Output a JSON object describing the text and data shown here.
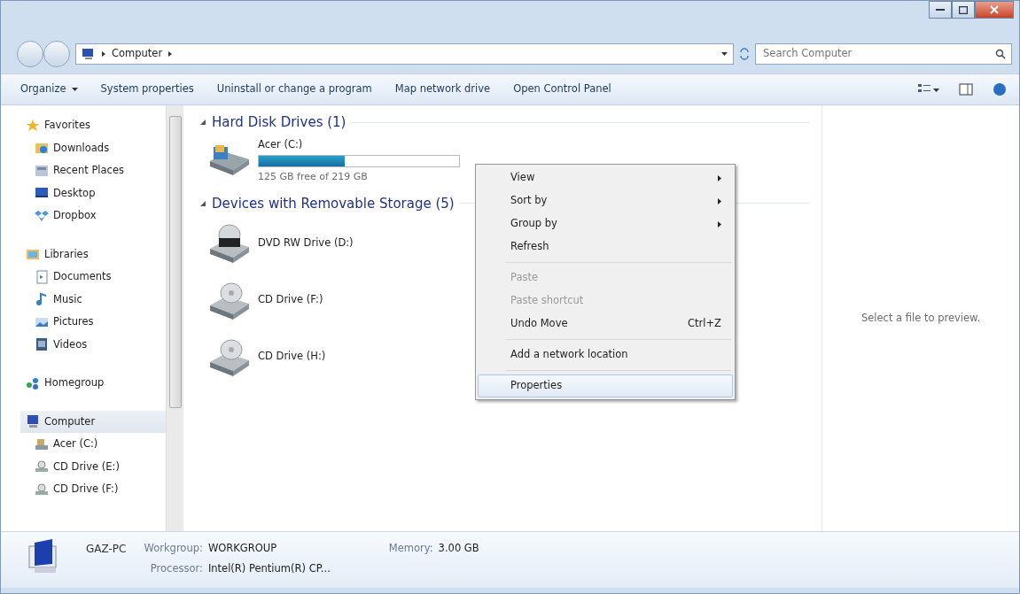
{
  "address_bar": {
    "crumbs": [
      "Computer"
    ],
    "search": {
      "placeholder": "Search Computer"
    }
  },
  "toolbar": {
    "buttons": [
      {
        "label": "Organize",
        "dropdown": true
      },
      {
        "label": "System properties",
        "dropdown": false
      },
      {
        "label": "Uninstall or change a program",
        "dropdown": false
      },
      {
        "label": "Map network drive",
        "dropdown": false
      },
      {
        "label": "Open Control Panel",
        "dropdown": false
      }
    ]
  },
  "nav_pane": {
    "groups": [
      {
        "label": "Favorites",
        "selected": false,
        "children": [
          {
            "label": "Downloads",
            "selected": false
          },
          {
            "label": "Recent Places",
            "selected": false
          },
          {
            "label": "Desktop",
            "selected": false
          },
          {
            "label": "Dropbox",
            "selected": false
          }
        ]
      },
      {
        "label": "Libraries",
        "selected": false,
        "children": [
          {
            "label": "Documents",
            "selected": false
          },
          {
            "label": "Music",
            "selected": false
          },
          {
            "label": "Pictures",
            "selected": false
          },
          {
            "label": "Videos",
            "selected": false
          }
        ]
      },
      {
        "label": "Homegroup",
        "selected": false
      },
      {
        "label": "Computer",
        "selected": true,
        "children": [
          {
            "label": "Acer (C:)",
            "selected": false
          },
          {
            "label": "CD Drive (E:)",
            "selected": false
          },
          {
            "label": "CD Drive (F:)",
            "selected": false
          }
        ]
      }
    ]
  },
  "content": {
    "groups": [
      {
        "title": "Hard Disk Drives (1)",
        "expanded": true,
        "items": [
          {
            "kind": "disk",
            "name": "Acer (C:)",
            "level": 0.43,
            "free": "125 GB free of 219 GB"
          }
        ]
      },
      {
        "title": "Devices with Removable Storage (5)",
        "expanded": true,
        "items": [
          {
            "kind": "dvd",
            "name": "DVD RW Drive (D:)"
          },
          {
            "kind": "cd",
            "name": "CD Drive (F:)"
          },
          {
            "kind": "cd",
            "name": "CD Drive (H:)"
          }
        ]
      }
    ]
  },
  "context_menu": {
    "items": [
      {
        "kind": "item",
        "label": "View",
        "submenu": true,
        "disabled": false,
        "selected": false
      },
      {
        "kind": "item",
        "label": "Sort by",
        "submenu": true,
        "disabled": false,
        "selected": false
      },
      {
        "kind": "item",
        "label": "Group by",
        "submenu": true,
        "disabled": false,
        "selected": false
      },
      {
        "kind": "item",
        "label": "Refresh",
        "submenu": false,
        "disabled": false,
        "selected": false
      },
      {
        "kind": "separator"
      },
      {
        "kind": "item",
        "label": "Paste",
        "submenu": false,
        "disabled": true,
        "selected": false
      },
      {
        "kind": "item",
        "label": "Paste shortcut",
        "submenu": false,
        "disabled": true,
        "selected": false
      },
      {
        "kind": "item",
        "label": "Undo Move",
        "shortcut": "Ctrl+Z",
        "submenu": false,
        "disabled": false,
        "selected": false
      },
      {
        "kind": "separator"
      },
      {
        "kind": "item",
        "label": "Add a network location",
        "submenu": false,
        "disabled": false,
        "selected": false
      },
      {
        "kind": "separator"
      },
      {
        "kind": "item",
        "label": "Properties",
        "submenu": false,
        "disabled": false,
        "selected": true
      }
    ]
  },
  "preview": {
    "message": "Select a file to preview."
  },
  "details": {
    "name": "GAZ-PC",
    "fields": [
      {
        "label": "Workgroup:",
        "value": "WORKGROUP"
      },
      {
        "label": "Memory:",
        "value": "3.00 GB"
      },
      {
        "label": "Processor:",
        "value": "Intel(R) Pentium(R) CP..."
      }
    ]
  }
}
